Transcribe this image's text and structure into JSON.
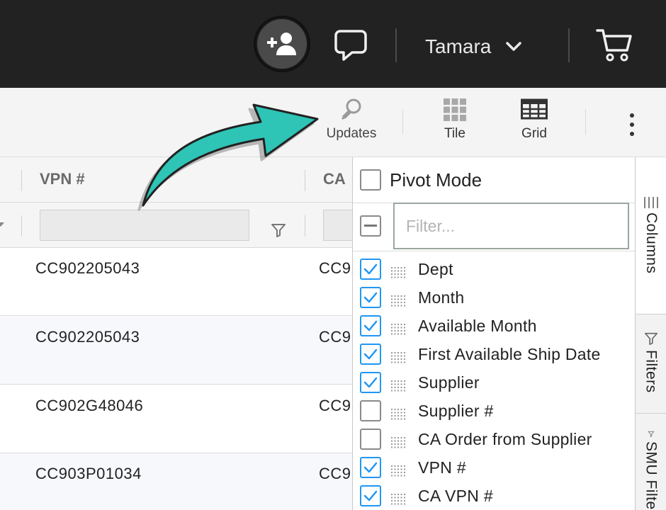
{
  "topbar": {
    "user_name": "Tamara",
    "icons": [
      "add-user-icon",
      "chat-icon",
      "chevron-down-icon",
      "cart-icon"
    ],
    "background": "#222222"
  },
  "toolbar": {
    "updates_label": "Updates",
    "tile_label": "Tile",
    "grid_label": "Grid",
    "icons": [
      "updates-icon",
      "tile-icon",
      "grid-icon",
      "more-vertical-icon"
    ]
  },
  "grid": {
    "headers": [
      "VPN #",
      "CA"
    ],
    "rows": [
      {
        "vpn": "CC902205043",
        "ca": "CC9"
      },
      {
        "vpn": "CC902205043",
        "ca": "CC9"
      },
      {
        "vpn": "CC902G48046",
        "ca": "CC9"
      },
      {
        "vpn": "CC903P01034",
        "ca": "CC9"
      }
    ]
  },
  "panel": {
    "pivot_mode_label": "Pivot Mode",
    "pivot_mode_checked": false,
    "filter_placeholder": "Filter...",
    "columns": [
      {
        "label": "Dept",
        "checked": true
      },
      {
        "label": "Month",
        "checked": true
      },
      {
        "label": "Available Month",
        "checked": true
      },
      {
        "label": "First Available Ship Date",
        "checked": true
      },
      {
        "label": "Supplier",
        "checked": true
      },
      {
        "label": "Supplier #",
        "checked": false
      },
      {
        "label": "CA Order from Supplier",
        "checked": false
      },
      {
        "label": "VPN #",
        "checked": true
      },
      {
        "label": "CA VPN #",
        "checked": true
      }
    ]
  },
  "side_tabs": {
    "columns_label": "Columns",
    "filters_label": "Filters",
    "smu_label": "SMU Filte"
  },
  "colors": {
    "accent_checkbox": "#2196f3",
    "annotation_arrow": "#2ec4b6"
  }
}
